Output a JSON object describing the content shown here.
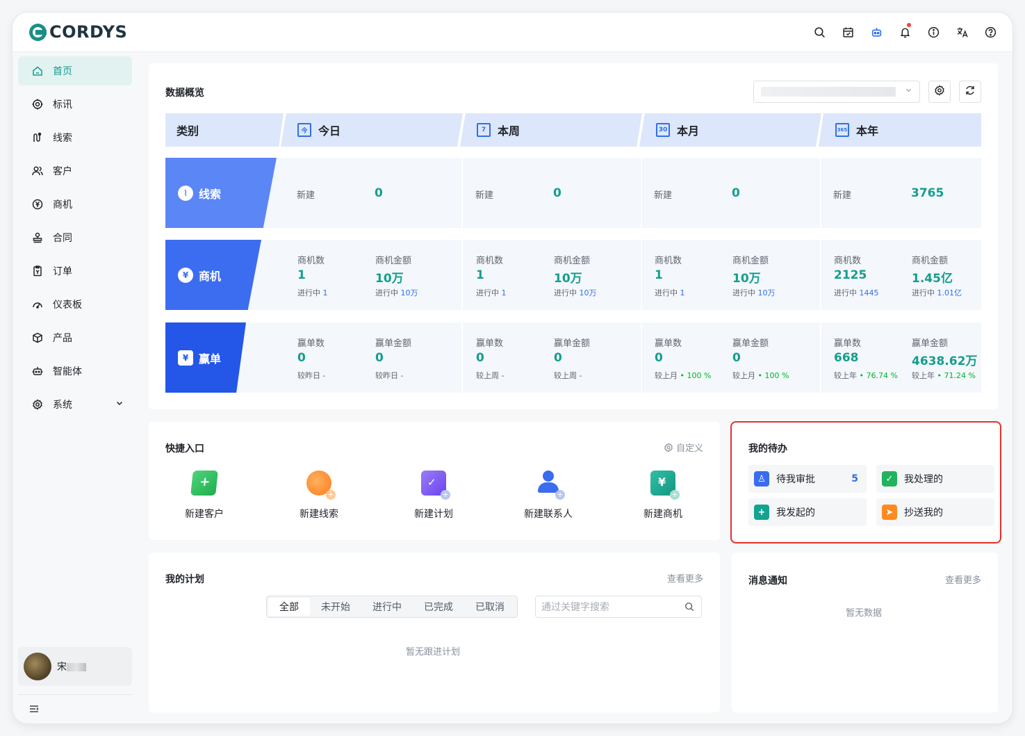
{
  "app": {
    "logo_text": "CORDYS"
  },
  "header_icons": [
    "search-icon",
    "calendar-icon",
    "robot-icon",
    "bell-icon",
    "info-icon",
    "translate-icon",
    "help-icon"
  ],
  "sidebar": {
    "items": [
      {
        "label": "首页",
        "icon": "home-icon",
        "active": true
      },
      {
        "label": "标讯",
        "icon": "target-icon"
      },
      {
        "label": "线索",
        "icon": "clue-icon"
      },
      {
        "label": "客户",
        "icon": "users-icon"
      },
      {
        "label": "商机",
        "icon": "yen-circle-icon"
      },
      {
        "label": "合同",
        "icon": "stamp-icon"
      },
      {
        "label": "订单",
        "icon": "order-icon"
      },
      {
        "label": "仪表板",
        "icon": "dashboard-icon"
      },
      {
        "label": "产品",
        "icon": "box-icon"
      },
      {
        "label": "智能体",
        "icon": "robot-icon"
      },
      {
        "label": "系统",
        "icon": "gear-icon",
        "has_submenu": true
      }
    ],
    "user": {
      "name": "宋"
    }
  },
  "overview": {
    "title": "数据概览",
    "header": {
      "category": "类别",
      "periods": [
        {
          "label": "今日",
          "icon_text": "今"
        },
        {
          "label": "本周",
          "icon_text": "7"
        },
        {
          "label": "本月",
          "icon_text": "30"
        },
        {
          "label": "本年",
          "icon_text": "365"
        }
      ]
    },
    "rows": {
      "clue": {
        "label": "线索",
        "color": "#5b86f5",
        "cells": [
          {
            "label": "新建",
            "value": "0"
          },
          {
            "label": "新建",
            "value": "0"
          },
          {
            "label": "新建",
            "value": "0"
          },
          {
            "label": "新建",
            "value": "3765"
          }
        ]
      },
      "opp": {
        "label": "商机",
        "color": "#3c6df0",
        "cells": [
          {
            "count_label": "商机数",
            "count": "1",
            "count_sub": "进行中",
            "count_sub_val": "1",
            "amt_label": "商机金额",
            "amt": "10万",
            "amt_sub": "进行中",
            "amt_sub_val": "10万"
          },
          {
            "count_label": "商机数",
            "count": "1",
            "count_sub": "进行中",
            "count_sub_val": "1",
            "amt_label": "商机金额",
            "amt": "10万",
            "amt_sub": "进行中",
            "amt_sub_val": "10万"
          },
          {
            "count_label": "商机数",
            "count": "1",
            "count_sub": "进行中",
            "count_sub_val": "1",
            "amt_label": "商机金额",
            "amt": "10万",
            "amt_sub": "进行中",
            "amt_sub_val": "10万"
          },
          {
            "count_label": "商机数",
            "count": "2125",
            "count_sub": "进行中",
            "count_sub_val": "1445",
            "amt_label": "商机金额",
            "amt": "1.45亿",
            "amt_sub": "进行中",
            "amt_sub_val": "1.01亿"
          }
        ]
      },
      "win": {
        "label": "赢单",
        "color": "#2456e8",
        "cells": [
          {
            "count_label": "赢单数",
            "count": "0",
            "count_sub": "较昨日 -",
            "count_sub_val": "",
            "amt_label": "赢单金额",
            "amt": "0",
            "amt_sub": "较昨日 -",
            "amt_sub_val": ""
          },
          {
            "count_label": "赢单数",
            "count": "0",
            "count_sub": "较上周 -",
            "count_sub_val": "",
            "amt_label": "赢单金额",
            "amt": "0",
            "amt_sub": "较上周 -",
            "amt_sub_val": ""
          },
          {
            "count_label": "赢单数",
            "count": "0",
            "count_sub": "较上月",
            "count_sub_val": "• 100 %",
            "amt_label": "赢单金额",
            "amt": "0",
            "amt_sub": "较上月",
            "amt_sub_val": "• 100 %"
          },
          {
            "count_label": "赢单数",
            "count": "668",
            "count_sub": "较上年",
            "count_sub_val": "• 76.74 %",
            "amt_label": "赢单金额",
            "amt": "4638.62万",
            "amt_sub": "较上年",
            "amt_sub_val": "• 71.24 %"
          }
        ]
      }
    }
  },
  "quick": {
    "title": "快捷入口",
    "customize": "自定义",
    "items": [
      {
        "label": "新建客户",
        "icon": "new-customer-icon",
        "color": "#33c462"
      },
      {
        "label": "新建线索",
        "icon": "new-clue-icon",
        "color": "#ff8a2a"
      },
      {
        "label": "新建计划",
        "icon": "new-plan-icon",
        "color": "#7b5cf0"
      },
      {
        "label": "新建联系人",
        "icon": "new-contact-icon",
        "color": "#3a6cf0"
      },
      {
        "label": "新建商机",
        "icon": "new-opportunity-icon",
        "color": "#1aa68f"
      }
    ]
  },
  "todo": {
    "title": "我的待办",
    "items": [
      {
        "label": "待我审批",
        "count": "5",
        "color": "#3a6cf0",
        "icon": "approval-icon"
      },
      {
        "label": "我处理的",
        "count": "",
        "color": "#23b35f",
        "icon": "check-icon"
      },
      {
        "label": "我发起的",
        "count": "",
        "color": "#14a390",
        "icon": "plus-icon"
      },
      {
        "label": "抄送我的",
        "count": "",
        "color": "#ff8a1f",
        "icon": "send-icon"
      }
    ]
  },
  "plan": {
    "title": "我的计划",
    "more": "查看更多",
    "tabs": [
      "全部",
      "未开始",
      "进行中",
      "已完成",
      "已取消"
    ],
    "search_placeholder": "通过关键字搜索",
    "empty": "暂无跟进计划"
  },
  "notice": {
    "title": "消息通知",
    "more": "查看更多",
    "empty": "暂无数据"
  }
}
